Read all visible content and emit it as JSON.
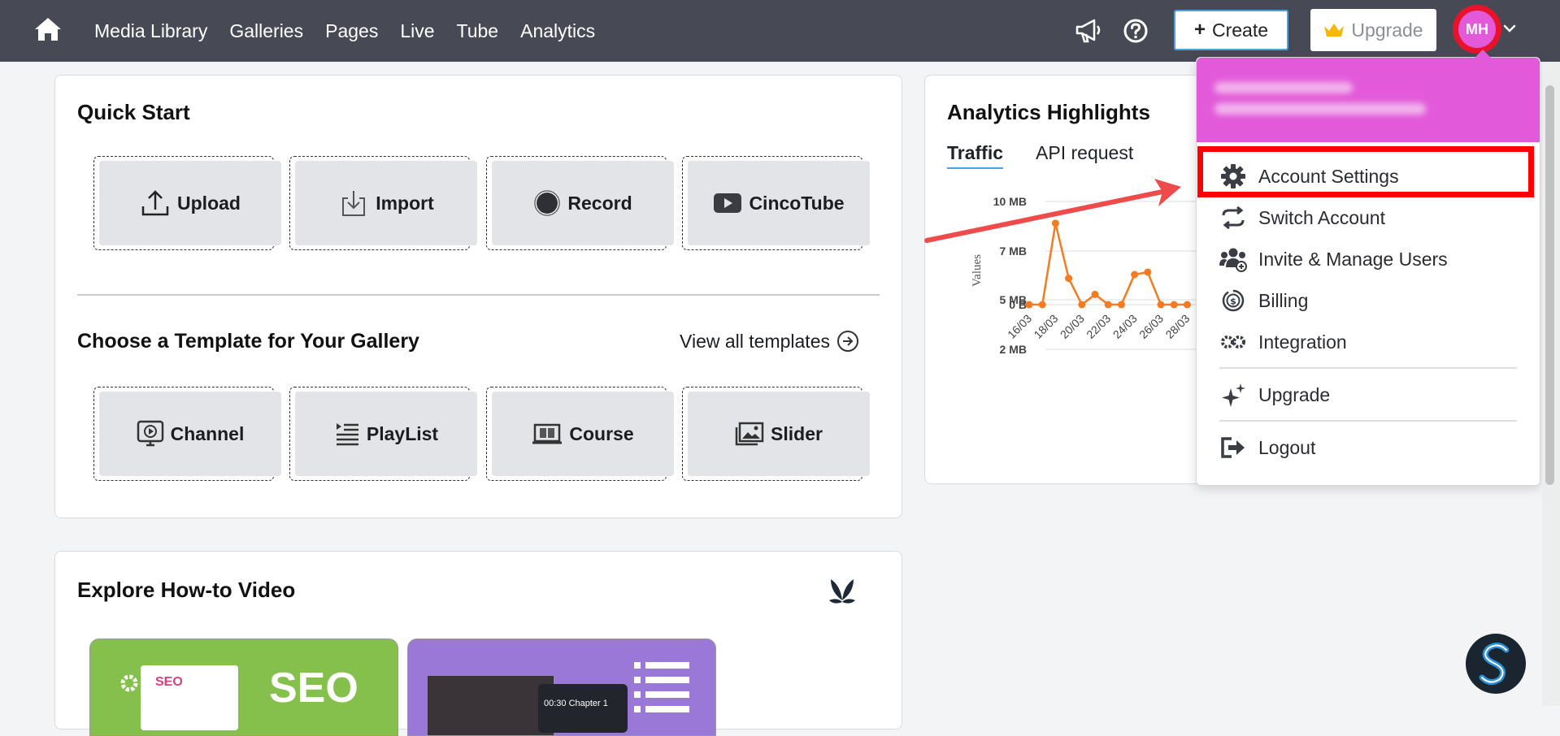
{
  "nav": {
    "items": [
      "Media Library",
      "Galleries",
      "Pages",
      "Live",
      "Tube",
      "Analytics"
    ],
    "create_label": "Create",
    "upgrade_label": "Upgrade",
    "avatar_initials": "MH"
  },
  "quick_start": {
    "title": "Quick Start",
    "tiles": [
      "Upload",
      "Import",
      "Record",
      "CincoTube"
    ],
    "template_title": "Choose a Template for Your Gallery",
    "view_all_label": "View all templates",
    "templates": [
      "Channel",
      "PlayList",
      "Course",
      "Slider"
    ]
  },
  "analytics": {
    "title": "Analytics Highlights",
    "tabs": [
      "Traffic",
      "API request"
    ],
    "active_tab": "Traffic"
  },
  "chart_data": {
    "type": "line",
    "ylabel": "Values",
    "y_ticks": [
      "10 MB",
      "7 MB",
      "5 MB",
      "2 MB",
      "0 B"
    ],
    "x_tick_labels": [
      "16/03",
      "18/03",
      "20/03",
      "22/03",
      "24/03",
      "26/03",
      "28/03"
    ],
    "x": [
      "16/03",
      "17/03",
      "18/03",
      "19/03",
      "20/03",
      "21/03",
      "22/03",
      "23/03",
      "24/03",
      "25/03",
      "26/03",
      "27/03",
      "28/03"
    ],
    "values": [
      0,
      0,
      7.4,
      1.8,
      0,
      0.7,
      0,
      0,
      2.1,
      2.4,
      0,
      0,
      0
    ],
    "units": "MB",
    "color": "#f47b20",
    "grid": true
  },
  "how_to": {
    "title": "Explore How-to Video",
    "thumb_text": "SEO",
    "thumb2_caption": "00:30 Chapter 1"
  },
  "dropdown": {
    "items": [
      {
        "label": "Account Settings",
        "icon": "gear-icon"
      },
      {
        "label": "Switch Account",
        "icon": "switch-icon"
      },
      {
        "label": "Invite & Manage Users",
        "icon": "users-icon"
      },
      {
        "label": "Billing",
        "icon": "billing-icon"
      },
      {
        "label": "Integration",
        "icon": "integration-icon"
      },
      {
        "label": "Upgrade",
        "icon": "sparkle-icon"
      },
      {
        "label": "Logout",
        "icon": "logout-icon"
      }
    ]
  },
  "colors": {
    "topbar": "#474a55",
    "accent": "#4aa3df",
    "dropdown_header": "#e25ad9",
    "highlight": "#ff0000",
    "chart_line": "#f47b20"
  }
}
